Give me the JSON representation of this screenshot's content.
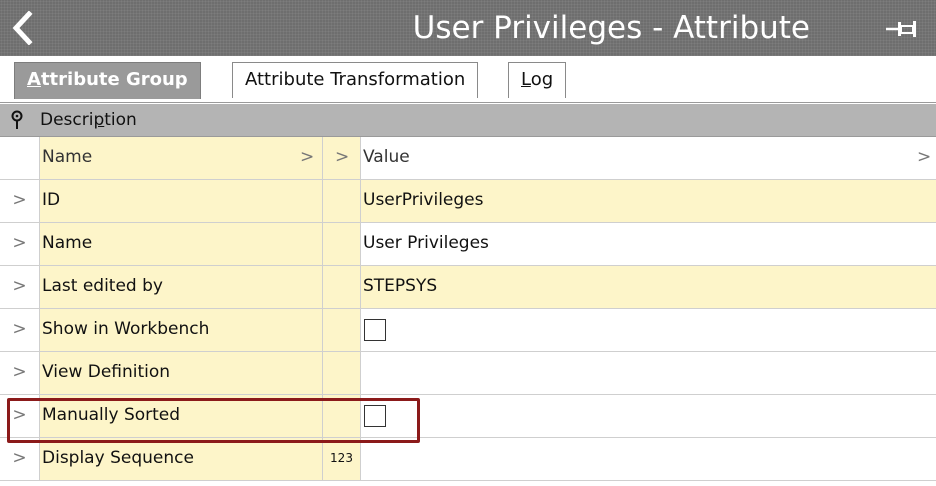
{
  "window": {
    "title": "User Privileges - Attribute",
    "back_icon": "chevron-left-icon",
    "pin_icon": "pin-icon"
  },
  "tabs": [
    {
      "label_pre": "",
      "label_u": "A",
      "label_post": "ttribute Group",
      "active": true
    },
    {
      "label_pre": "Attribute Transformation",
      "label_u": "",
      "label_post": "",
      "active": false
    },
    {
      "label_pre": "",
      "label_u": "L",
      "label_post": "og",
      "active": false
    }
  ],
  "section": {
    "label_pre": "Descri",
    "label_u": "p",
    "label_post": "tion",
    "icon": "pushpin-icon"
  },
  "table": {
    "headers": {
      "name": "Name",
      "value": "Value",
      "sort_glyph": ">"
    },
    "rows": [
      {
        "name": "ID",
        "value": "UserPrivileges",
        "type": "",
        "kind": "text",
        "value_highlight": true
      },
      {
        "name": "Name",
        "value": "User Privileges",
        "type": "",
        "kind": "text",
        "value_highlight": false
      },
      {
        "name": "Last edited by",
        "value": "STEPSYS",
        "type": "",
        "kind": "text",
        "value_highlight": true
      },
      {
        "name": "Show in Workbench",
        "value": "",
        "type": "",
        "kind": "checkbox",
        "checked": false
      },
      {
        "name": "View Definition",
        "value": "",
        "type": "",
        "kind": "text",
        "value_highlight": false
      },
      {
        "name": "Manually Sorted",
        "value": "",
        "type": "",
        "kind": "checkbox",
        "checked": false
      },
      {
        "name": "Display Sequence",
        "value": "",
        "type": "123",
        "kind": "text",
        "value_highlight": false
      }
    ],
    "expand_glyph": ">"
  },
  "colors": {
    "title_bar": "#6e6e6e",
    "active_tab": "#9a9a9a",
    "name_column": "#fdf5c9",
    "highlight_box": "#8b1a1a"
  }
}
